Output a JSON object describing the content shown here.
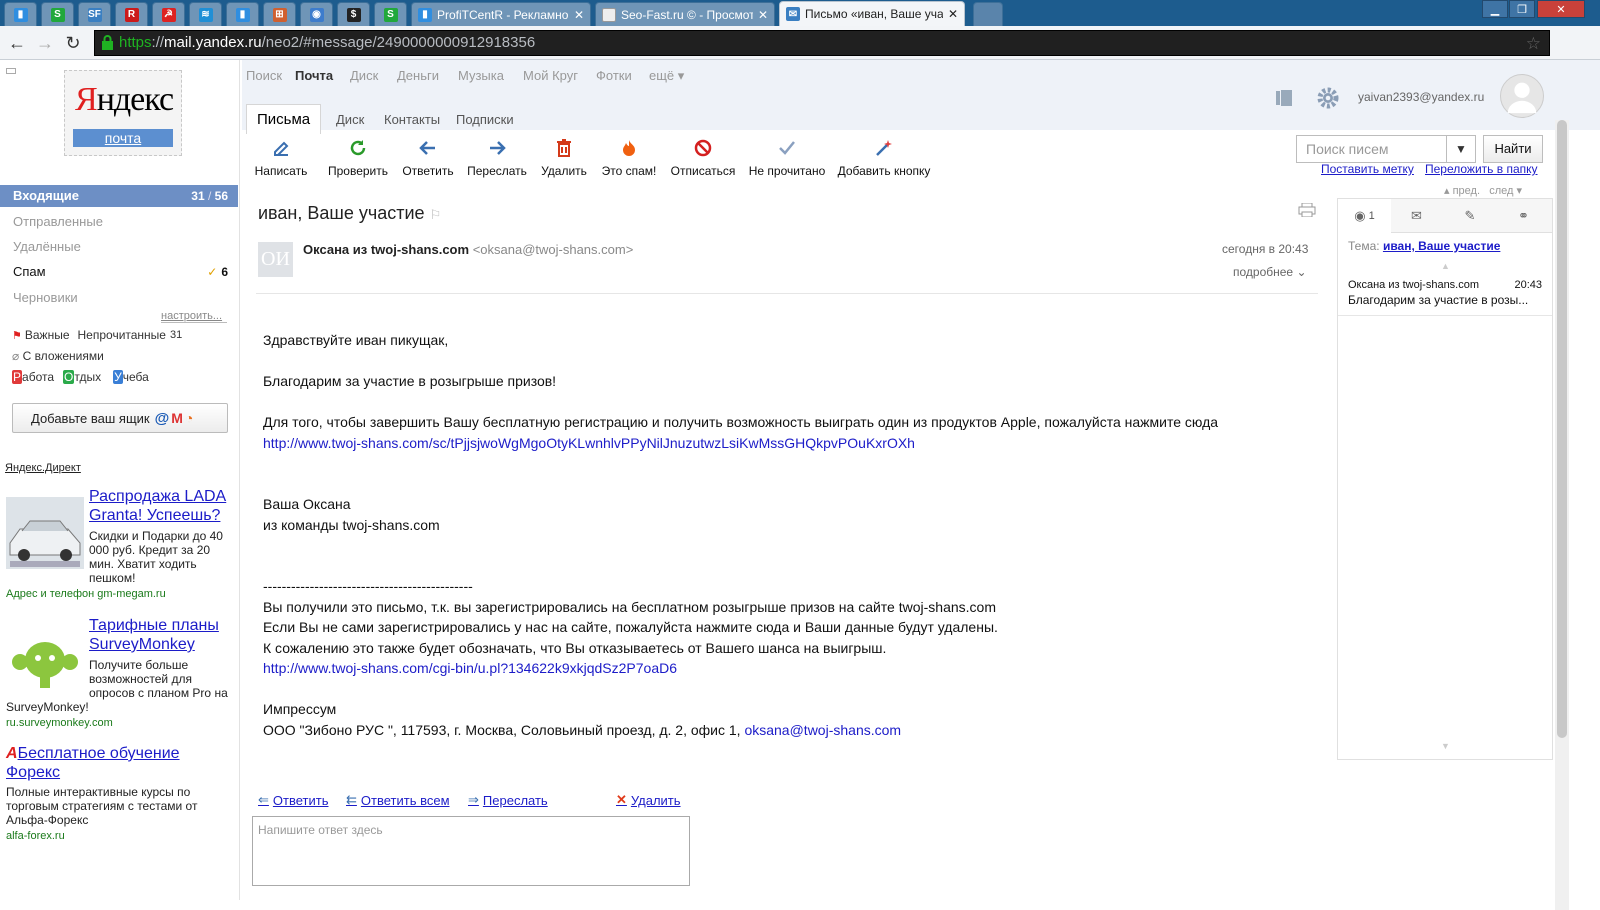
{
  "browser": {
    "tabs": [
      {
        "kind": "pin",
        "color": "#2f8ee0",
        "glyph": "▮",
        "icon": "chart-icon"
      },
      {
        "kind": "pin",
        "color": "#21a83b",
        "glyph": "S",
        "icon": "seo-s-icon"
      },
      {
        "kind": "pin",
        "color": "#3a7fc2",
        "glyph": "SF",
        "icon": "sf-icon"
      },
      {
        "kind": "pin",
        "color": "#cc1a1a",
        "glyph": "R",
        "icon": "r-icon"
      },
      {
        "kind": "pin",
        "color": "#d22",
        "glyph": "☭",
        "icon": "round-red-icon"
      },
      {
        "kind": "pin",
        "color": "#1f8fd6",
        "glyph": "≋",
        "icon": "wave-icon"
      },
      {
        "kind": "pin",
        "color": "#2f8ee0",
        "glyph": "▮",
        "icon": "chart-icon"
      },
      {
        "kind": "pin",
        "color": "#d06030",
        "glyph": "⊞",
        "icon": "grid-icon"
      },
      {
        "kind": "pin",
        "color": "#3d7ccc",
        "glyph": "◉",
        "icon": "shield-icon"
      },
      {
        "kind": "pin",
        "color": "#222",
        "glyph": "$",
        "icon": "money-bag-icon"
      },
      {
        "kind": "pin",
        "color": "#21a83b",
        "glyph": "S",
        "icon": "seo-s-icon"
      },
      {
        "kind": "tab",
        "color": "#2f8ee0",
        "glyph": "▮",
        "icon": "chart-icon",
        "title": "ProfiTCentR - Рекламное"
      },
      {
        "kind": "tab",
        "color": "#eee",
        "glyph": "",
        "icon": "doc-icon",
        "title": "Seo-Fast.ru © - Просмотр"
      },
      {
        "kind": "active",
        "color": "#3a7fc2",
        "glyph": "✉",
        "icon": "mail-icon",
        "title": "Письмо «иван, Ваше уча"
      }
    ],
    "url": {
      "scheme": "https",
      "sep": "://",
      "host": "mail.yandex.ru",
      "path": "/neo2/#message/2490000000912918356"
    }
  },
  "logo": {
    "word_red": "Я",
    "word_rest": "ндекс",
    "product": "почта"
  },
  "services": [
    "Поиск",
    "Почта",
    "Диск",
    "Деньги",
    "Музыка",
    "Мой Круг",
    "Фотки",
    "ещё ▾"
  ],
  "subtabs": [
    "Письма",
    "Диск",
    "Контакты",
    "Подписки"
  ],
  "toolbar": [
    {
      "label": "Написать",
      "icon": "compose-icon",
      "color": "#3a6fb0"
    },
    {
      "label": "Проверить",
      "icon": "refresh-icon",
      "color": "#2a9a2a"
    },
    {
      "label": "Ответить",
      "icon": "reply-icon",
      "color": "#3a6fb0"
    },
    {
      "label": "Переслать",
      "icon": "forward-icon",
      "color": "#3a6fb0"
    },
    {
      "label": "Удалить",
      "icon": "trash-icon",
      "color": "#d43a1a"
    },
    {
      "label": "Это спам!",
      "icon": "flame-icon",
      "color": "#f06010"
    },
    {
      "label": "Отписаться",
      "icon": "block-icon",
      "color": "#d42020"
    },
    {
      "label": "Не прочитано",
      "icon": "check-icon",
      "color": "#8aa0c0"
    },
    {
      "label": "Добавить кнопку",
      "icon": "magic-wand-icon",
      "color": "#e04040"
    }
  ],
  "user": {
    "email": "yaivan2393@yandex.ru"
  },
  "search": {
    "placeholder": "Поиск писем",
    "button": "Найти",
    "drop": "▼"
  },
  "actions": {
    "label": "Поставить метку",
    "move": "Переложить в папку",
    "prev": "▴ пред.",
    "next": "след ▾"
  },
  "folders": [
    {
      "name": "Входящие",
      "count_unread": "31",
      "count_total": "56",
      "active": true
    },
    {
      "name": "Отправленные"
    },
    {
      "name": "Удалённые"
    },
    {
      "name": "Спам",
      "count": "6",
      "spam": true
    },
    {
      "name": "Черновики"
    }
  ],
  "sidebar": {
    "setup": "настроить...",
    "important": "Важные",
    "unread": "Непрочитанные",
    "unread_count": "31",
    "attachments": "С вложениями",
    "labels": [
      {
        "letter": "Р",
        "rest": "абота",
        "color": "#e03a3a"
      },
      {
        "letter": "О",
        "rest": "тдых",
        "color": "#2aaa4a"
      },
      {
        "letter": "У",
        "rest": "чеба",
        "color": "#3a7fd6"
      }
    ],
    "add_mailbox": "Добавьте ваш ящик",
    "direct": "Яндекс.Директ"
  },
  "ads": [
    {
      "title": "Распродажа LADA Granta! Успеешь?",
      "text": "Скидки и Подарки до 40 000 руб. Кредит за 20 мин. Хватит ходить пешком!",
      "url": "Адрес и телефон  gm-megam.ru",
      "icon": "car-image"
    },
    {
      "title": "Тарифные планы SurveyMonkey",
      "text": "Получите больше возможностей для опросов с планом Pro на SurveyMonkey!",
      "url": "ru.surveymonkey.com",
      "icon": "surveymonkey-logo"
    },
    {
      "title": "Бесплатное обучение Форекс",
      "text": "Полные интерактивные курсы по торговым стратегиям с тестами от Альфа-Форекс",
      "url": "alfa-forex.ru",
      "icon": "alfa-logo"
    }
  ],
  "message": {
    "subject": "иван, Ваше участие",
    "avatar": "ОИ",
    "from_name": "Оксана из twoj-shans.com",
    "from_email": "<oksana@twoj-shans.com>",
    "date": "сегодня в 20:43",
    "more": "подробнее",
    "body": [
      "Здравствуйте иван пикущак,",
      "",
      "Благодарим за участие в розыгрыше призов!",
      "",
      "Для того, чтобы завершить Вашу бесплатную регистрацию и получить возможность выиграть один из продуктов Apple, пожалуйста нажмите сюда",
      {
        "link": "http://www.twoj-shans.com/sc/tPjjsjwoWgMgoOtyKLwnhlvPPyNilJnuzutwzLsiKwMssGHQkpvPOuKxrOXh"
      },
      "",
      "",
      "Ваша Оксана",
      "из команды twoj-shans.com",
      "",
      "",
      "---------------------------------------------",
      "Вы получили это письмо, т.к. вы зарегистрировались на бесплатном розыгрыше призов на сайте twoj-shans.com",
      "Если Вы не сами зарегистрировались у нас на сайте, пожалуйста нажмите сюда и Ваши данные будут удалены.",
      "К сожалению это также  будет обозначать, что Вы отказываетесь от Вашего шанса на выигрыш.",
      {
        "link": "http://www.twoj-shans.com/cgi-bin/u.pl?134622k9xkjqdSz2P7oaD6"
      },
      "",
      "Импрессум",
      {
        "text": "ООО \"Зибоно РУС \", 117593, г. Москва, Соловьиный проезд, д. 2, офис 1, ",
        "link": "oksana@twoj-shans.com"
      }
    ]
  },
  "footer": {
    "reply": "Ответить",
    "reply_all": "Ответить всем",
    "forward": "Переслать",
    "delete": "Удалить",
    "placeholder": "Напишите ответ здесь"
  },
  "thread": {
    "tabs": [
      {
        "label": "1",
        "icon": "chat-icon"
      },
      {
        "label": "",
        "icon": "envelope-icon"
      },
      {
        "label": "",
        "icon": "paperclip-icon"
      },
      {
        "label": "",
        "icon": "link-icon"
      }
    ],
    "tema_label": "Тема:",
    "tema": "иван, Ваше участие",
    "item_from": "Оксана из twoj-shans.com",
    "item_time": "20:43",
    "item_text": "Благодарим за участие в розы..."
  }
}
